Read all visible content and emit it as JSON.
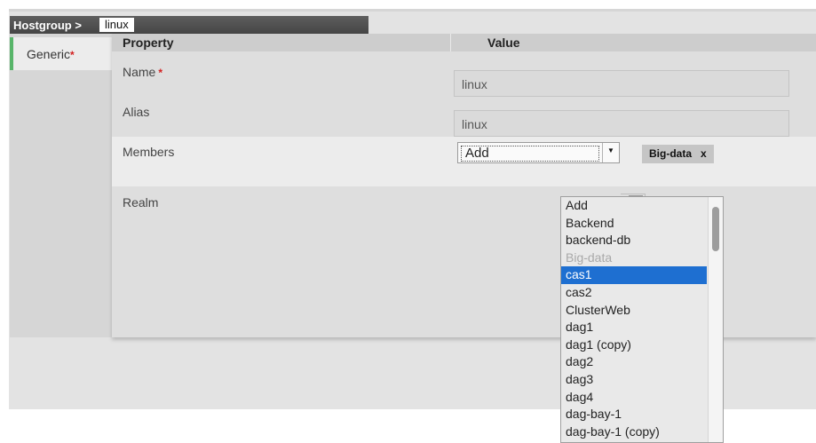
{
  "breadcrumb": {
    "section": "Hostgroup >",
    "current": "linux"
  },
  "tabs": [
    {
      "label": "Generic",
      "required": "*"
    }
  ],
  "table": {
    "property_header": "Property",
    "value_header": "Value"
  },
  "fields": {
    "name": {
      "label": "Name",
      "required": "*",
      "value": "linux"
    },
    "alias": {
      "label": "Alias",
      "value": "linux"
    },
    "members": {
      "label": "Members",
      "select_value": "Add",
      "tags": [
        {
          "label": "Big-data",
          "remove": "x"
        }
      ]
    },
    "realm": {
      "label": "Realm"
    }
  },
  "dropdown": {
    "options": [
      {
        "label": "Add"
      },
      {
        "label": "Backend"
      },
      {
        "label": "backend-db"
      },
      {
        "label": "Big-data",
        "state": "disabled"
      },
      {
        "label": "cas1",
        "state": "selected"
      },
      {
        "label": "cas2"
      },
      {
        "label": "ClusterWeb"
      },
      {
        "label": "dag1"
      },
      {
        "label": "dag1 (copy)"
      },
      {
        "label": "dag2"
      },
      {
        "label": "dag3"
      },
      {
        "label": "dag4"
      },
      {
        "label": "dag-bay-1"
      },
      {
        "label": "dag-bay-1 (copy)"
      }
    ]
  },
  "colors": {
    "accent": "#58b56a",
    "selection": "#1e6fd1",
    "required": "#d32020",
    "header_bar": "#4f4f4f"
  },
  "icons": {
    "select_arrow": "caret-down-icon"
  }
}
